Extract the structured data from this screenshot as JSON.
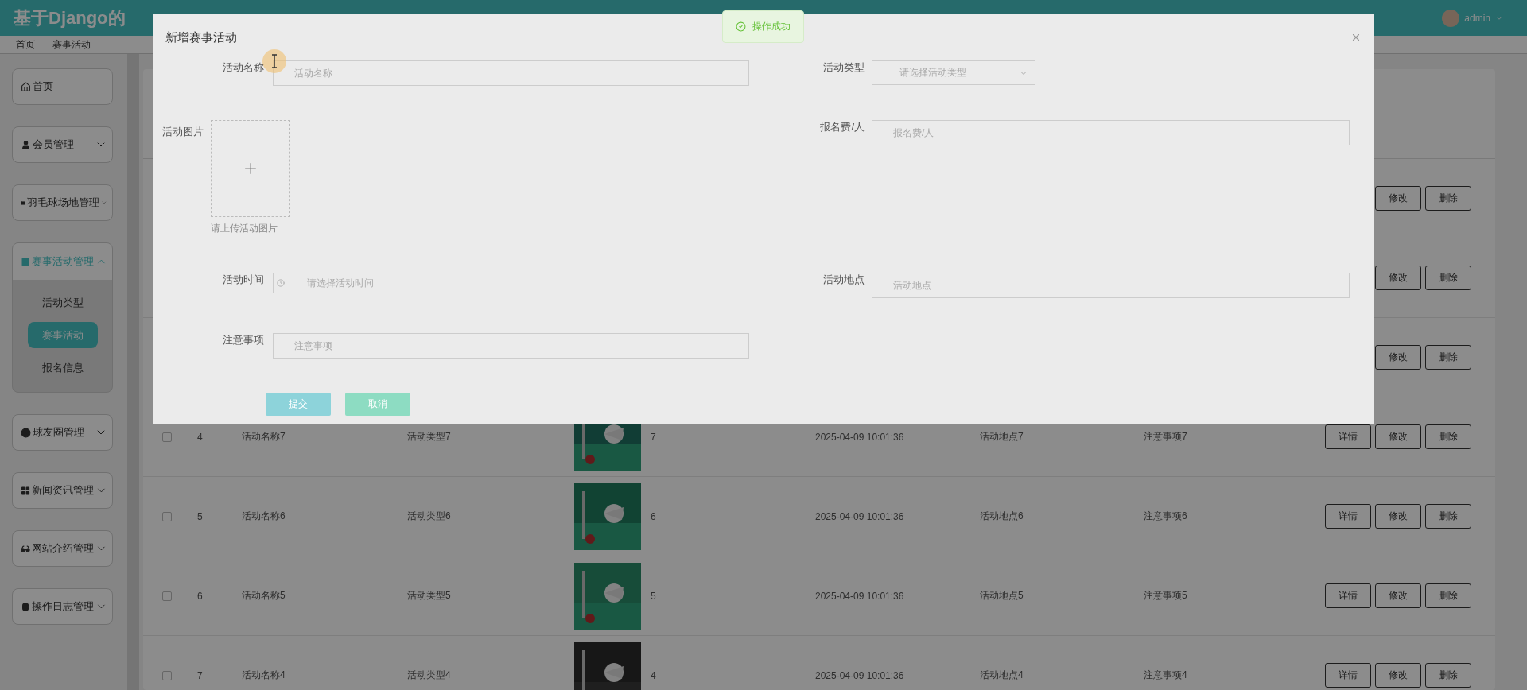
{
  "header": {
    "title": "基于Django的",
    "user": "admin"
  },
  "breadcrumb": [
    "首页",
    "赛事活动"
  ],
  "sidebar": {
    "items": [
      {
        "kind": "link",
        "label": "首页"
      },
      {
        "kind": "group",
        "label": "会员管理",
        "expanded": false
      },
      {
        "kind": "group",
        "label": "羽毛球场地管理",
        "expanded": false
      },
      {
        "kind": "group",
        "label": "赛事活动管理",
        "expanded": true,
        "children": [
          {
            "label": "活动类型",
            "selected": false
          },
          {
            "label": "赛事活动",
            "selected": true
          },
          {
            "label": "报名信息",
            "selected": false
          }
        ]
      },
      {
        "kind": "group",
        "label": "球友圈管理",
        "expanded": false
      },
      {
        "kind": "group",
        "label": "新闻资讯管理",
        "expanded": false
      },
      {
        "kind": "group",
        "label": "网站介绍管理",
        "expanded": false
      },
      {
        "kind": "group",
        "label": "操作日志管理",
        "expanded": false
      }
    ]
  },
  "table": {
    "rows": [
      {
        "kind": "covered",
        "actions": [
          "修改",
          "删除"
        ]
      },
      {
        "kind": "covered",
        "actions": [
          "修改",
          "删除"
        ]
      },
      {
        "kind": "covered",
        "actions": [
          "修改",
          "删除"
        ]
      },
      {
        "kind": "full",
        "checked": false,
        "index": "4",
        "name": "活动名称7",
        "type": "活动类型7",
        "image": {
          "kind": "picture"
        },
        "fee": "7",
        "time": "2025-04-09 10:01:36",
        "place": "活动地点7",
        "note": "注意事项7",
        "actions": [
          "详情",
          "修改",
          "删除"
        ]
      },
      {
        "kind": "full",
        "checked": false,
        "index": "5",
        "name": "活动名称6",
        "type": "活动类型6",
        "image": {
          "kind": "picture"
        },
        "fee": "6",
        "time": "2025-04-09 10:01:36",
        "place": "活动地点6",
        "note": "注意事项6",
        "actions": [
          "详情",
          "修改",
          "删除"
        ]
      },
      {
        "kind": "full",
        "checked": false,
        "index": "6",
        "name": "活动名称5",
        "type": "活动类型5",
        "image": {
          "kind": "picture"
        },
        "fee": "5",
        "time": "2025-04-09 10:01:36",
        "place": "活动地点5",
        "note": "注意事项5",
        "actions": [
          "详情",
          "修改",
          "删除"
        ]
      },
      {
        "kind": "full",
        "checked": false,
        "index": "7",
        "name": "活动名称4",
        "type": "活动类型4",
        "image": {
          "kind": "picture"
        },
        "fee": "4",
        "time": "2025-04-09 10:01:36",
        "place": "活动地点4",
        "note": "注意事项4",
        "actions": [
          "详情",
          "修改",
          "删除"
        ]
      }
    ]
  },
  "dialog": {
    "title": "新增赛事活动",
    "rows": [
      [
        {
          "kind": "text",
          "label": "活动名称",
          "placeholder": "活动名称"
        },
        {
          "kind": "select",
          "label": "活动类型",
          "placeholder": "请选择活动类型"
        }
      ],
      [
        {
          "kind": "upload",
          "label": "活动图片",
          "hint": "请上传活动图片"
        },
        {
          "kind": "text",
          "label": "报名费/人",
          "placeholder": "报名费/人"
        }
      ],
      [
        {
          "kind": "datetime",
          "label": "活动时间",
          "placeholder": "请选择活动时间"
        },
        {
          "kind": "text",
          "label": "活动地点",
          "placeholder": "活动地点"
        }
      ],
      [
        {
          "kind": "text",
          "label": "注意事项",
          "placeholder": "注意事项"
        }
      ]
    ],
    "buttons": [
      {
        "kind": "submit",
        "label": "提交"
      },
      {
        "kind": "cancel",
        "label": "取消"
      }
    ]
  },
  "toast": {
    "message": "操作成功"
  }
}
